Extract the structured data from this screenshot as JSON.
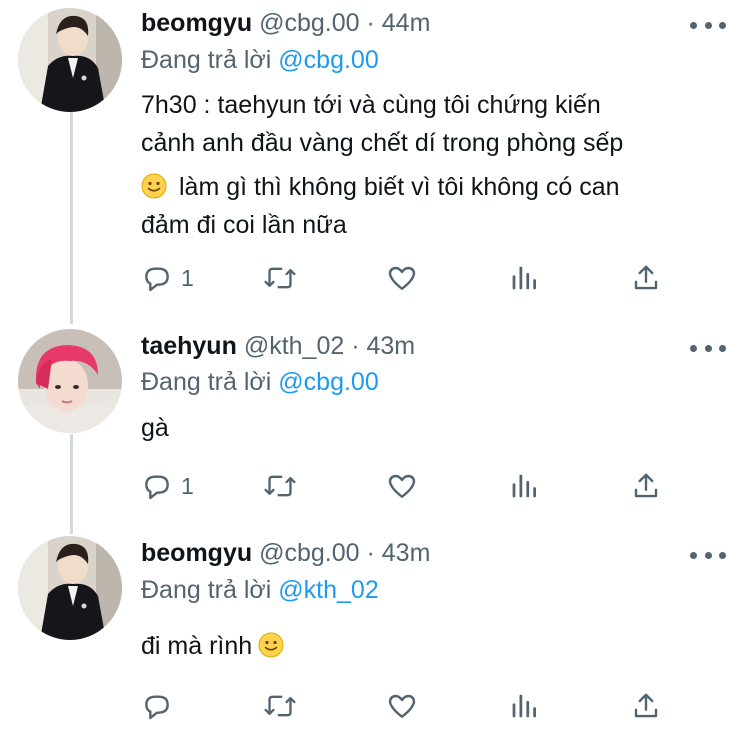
{
  "tweets": [
    {
      "display_name": "beomgyu",
      "handle": "@cbg.00",
      "separator": "·",
      "time": "44m",
      "reply_prefix": "Đang trả lời",
      "reply_to": "@cbg.00",
      "lines": [
        "7h30 : taehyun tới và cùng tôi chứng kiến",
        "cảnh anh đầu vàng chết dí trong phòng sếp",
        "làm gì thì không biết vì tôi không có can",
        "đảm đi coi lần nữa"
      ],
      "reply_count": "1"
    },
    {
      "display_name": "taehyun",
      "handle": "@kth_02",
      "separator": "·",
      "time": "43m",
      "reply_prefix": "Đang trả lời",
      "reply_to": "@cbg.00",
      "lines": [
        "gà"
      ],
      "reply_count": "1"
    },
    {
      "display_name": "beomgyu",
      "handle": "@cbg.00",
      "separator": "·",
      "time": "43m",
      "reply_prefix": "Đang trả lời",
      "reply_to": "@kth_02",
      "lines": [
        "đi mà rình"
      ],
      "reply_count": ""
    }
  ],
  "icons": {
    "reply": "reply-icon",
    "retweet": "retweet-icon",
    "like": "heart-icon",
    "analytics": "analytics-icon",
    "share": "share-icon",
    "more": "more-icon",
    "emoji": "slightly-smiling-face-emoji"
  },
  "colors": {
    "text": "#0f1419",
    "secondary": "#536471",
    "mention": "#1d9bf0",
    "thread_line": "#cfd9de"
  }
}
